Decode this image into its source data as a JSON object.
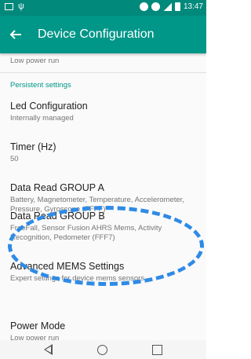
{
  "status_bar": {
    "time": "13:47",
    "icons": [
      "notification-icon",
      "usb-icon",
      "bluetooth-icon",
      "data-icon",
      "signal-icon",
      "battery-icon"
    ]
  },
  "app_bar": {
    "title": "Device Configuration",
    "back_icon": "arrow-back-icon"
  },
  "settings": {
    "low_power_summary": "Low power run",
    "section_header": "Persistent settings",
    "items": [
      {
        "title": "Led Configuration",
        "summary": "Internally managed"
      },
      {
        "title": "Timer (Hz)",
        "summary": "50"
      },
      {
        "title": "Data Read GROUP A",
        "summary": "Battery, Magnetometer, Temperature, Accelerometer, Pressure, Gyroscope (FFFF)"
      },
      {
        "title": "Data Read GROUP B",
        "summary": "FreeFall, Sensor Fusion AHRS Mems, Activity Recognition, Pedometer (FFF7)"
      },
      {
        "title": "Advanced MEMS Settings",
        "summary": "Expert settings for device mems sensors"
      },
      {
        "title": "Power Mode",
        "summary": "Low power run"
      }
    ]
  },
  "annotation": {
    "highlighted_item": "Data Read GROUP B",
    "color": "#2e8be6"
  },
  "nav_bar": {
    "icons": [
      "nav-back-icon",
      "nav-home-icon",
      "nav-recent-apps-icon"
    ]
  },
  "colors": {
    "primary": "#009688",
    "primary_dark": "#01897b",
    "accent_header": "#009688"
  }
}
